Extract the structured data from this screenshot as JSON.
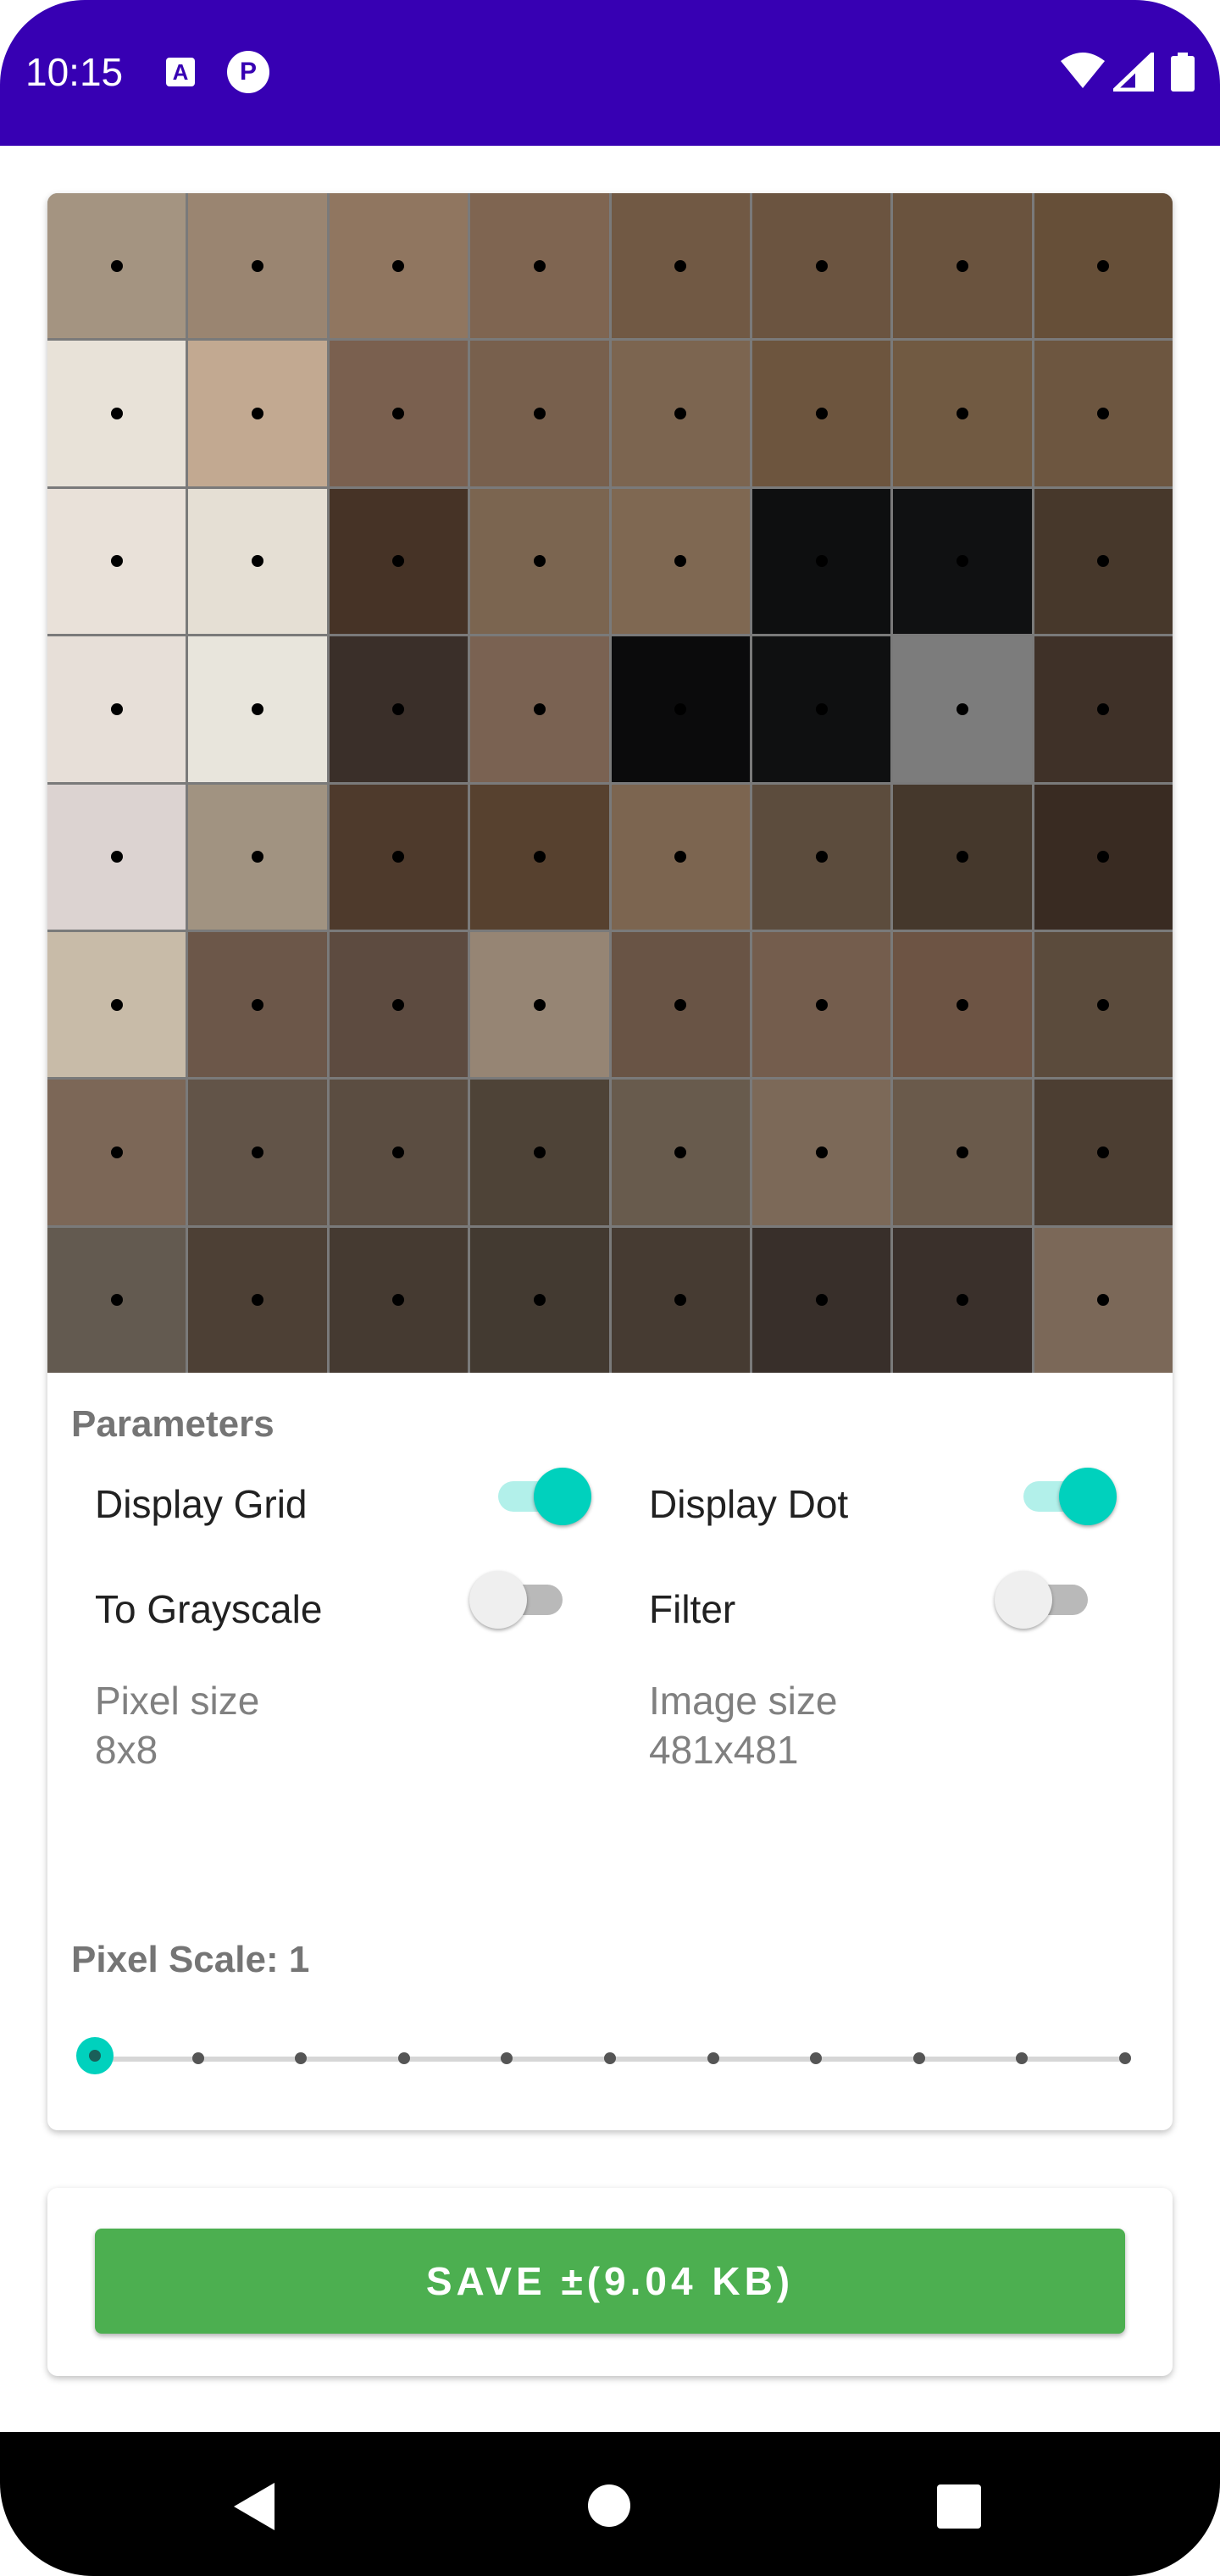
{
  "status_bar": {
    "time": "10:15",
    "icons": [
      "a-icon",
      "p-icon",
      "wifi-icon",
      "signal-icon",
      "battery-icon"
    ],
    "color": "#3700b3"
  },
  "pixel_grid": {
    "columns": 8,
    "rows": 8,
    "colors": [
      [
        "#a49481",
        "#9a8571",
        "#907660",
        "#7f6551",
        "#715944",
        "#6b5440",
        "#6a533e",
        "#664f38"
      ],
      [
        "#e8e2d8",
        "#c2a991",
        "#7a604f",
        "#78604d",
        "#7c6550",
        "#6d553e",
        "#715a42",
        "#6d5640"
      ],
      [
        "#e9e1d9",
        "#e5dfd4",
        "#463326",
        "#7b6550",
        "#7f6852",
        "#0e0f10",
        "#101112",
        "#47382b"
      ],
      [
        "#e7dfd8",
        "#e8e5dc",
        "#3a2f29",
        "#7a6252",
        "#0b0b0c",
        "#0f1011",
        "#7c7c7c",
        "#3f3128"
      ],
      [
        "#dcd3d1",
        "#a19381",
        "#4e3a2c",
        "#57412f",
        "#7c6550",
        "#5c4c3d",
        "#45382c",
        "#392b22"
      ],
      [
        "#c8bba8",
        "#6c5749",
        "#5d4b40",
        "#968574",
        "#695445",
        "#745d4d",
        "#6d5444",
        "#5b4b3c"
      ],
      [
        "#7c6757",
        "#625448",
        "#5b4d41",
        "#4e4337",
        "#685b4d",
        "#7c6958",
        "#6a5a4b",
        "#4c3e32"
      ],
      [
        "#635a50",
        "#4d4035",
        "#453a31",
        "#433a31",
        "#463b32",
        "#382f2a",
        "#3a302b",
        "#7b6858"
      ]
    ]
  },
  "parameters": {
    "title": "Parameters",
    "display_grid": {
      "label": "Display Grid",
      "on": true
    },
    "display_dot": {
      "label": "Display Dot",
      "on": true
    },
    "to_grayscale": {
      "label": "To Grayscale",
      "on": false
    },
    "filter": {
      "label": "Filter",
      "on": false
    },
    "pixel_size": {
      "label": "Pixel size",
      "value": "8x8"
    },
    "image_size": {
      "label": "Image size",
      "value": "481x481"
    }
  },
  "pixel_scale": {
    "label": "Pixel Scale: 1",
    "value": 1,
    "min": 1,
    "max": 11,
    "steps": 11
  },
  "save": {
    "label": "SAVE ±(9.04 KB)",
    "color": "#4caf50"
  },
  "accent_color": "#00d1bd",
  "nav_bar": {
    "icons": [
      "back-icon",
      "home-icon",
      "recents-icon"
    ]
  }
}
